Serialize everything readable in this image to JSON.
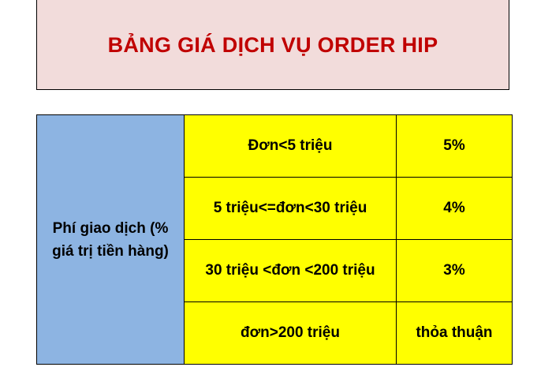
{
  "title": "BẢNG GIÁ DỊCH VỤ ORDER HIP",
  "colors": {
    "title_background": "#f2dcdb",
    "title_text": "#c00000",
    "label_cell_background": "#8db4e2",
    "rate_cell_background": "#ffff00"
  },
  "table": {
    "label_line1": "Phí giao dịch (%",
    "label_line2": "giá trị tiền hàng)",
    "rows": [
      {
        "range": "Đơn<5 triệu",
        "fee": "5%"
      },
      {
        "range": "5 triệu<=đơn<30 triệu",
        "fee": "4%"
      },
      {
        "range": "30 triệu <đơn <200 triệu",
        "fee": "3%"
      },
      {
        "range": "đơn>200 triệu",
        "fee": "thỏa thuận"
      }
    ]
  }
}
